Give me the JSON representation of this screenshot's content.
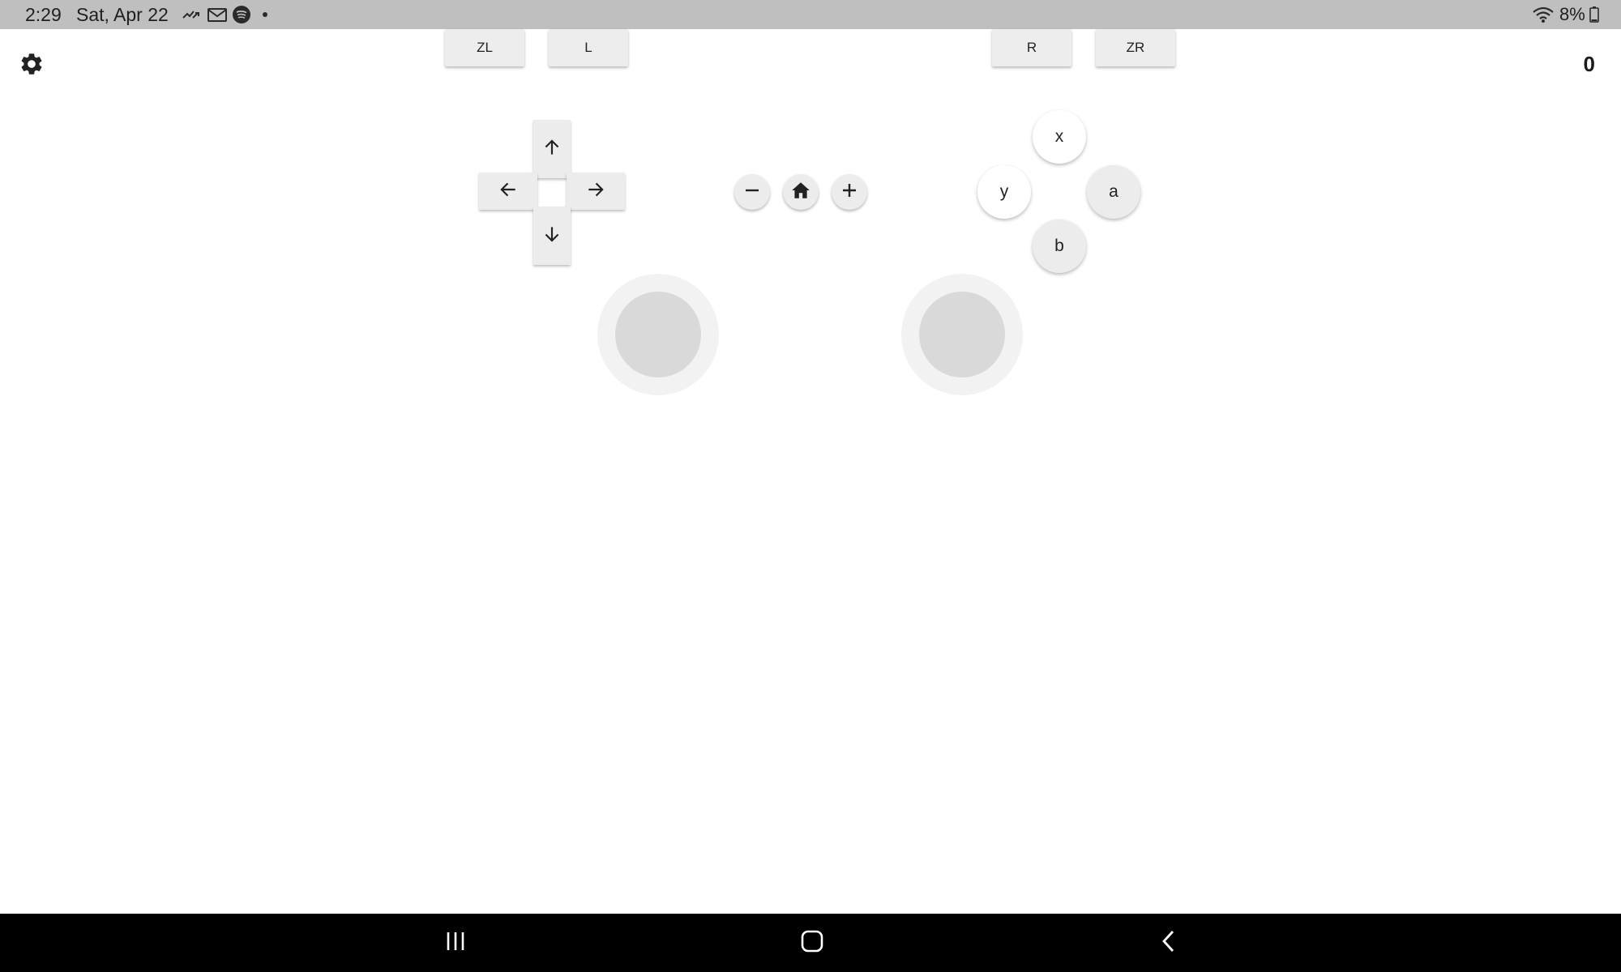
{
  "status_bar": {
    "time": "2:29",
    "date": "Sat, Apr 22",
    "notification_icons": [
      "missed-call-icon",
      "gmail-icon",
      "spotify-icon",
      "more-dot-icon"
    ],
    "battery_text": "8%",
    "background": "#bfbfbf"
  },
  "app": {
    "counter": "0",
    "shoulder_buttons": {
      "zl": "ZL",
      "l": "L",
      "r": "R",
      "zr": "ZR"
    },
    "face_buttons": {
      "x": "x",
      "y": "y",
      "a": "a",
      "b": "b"
    },
    "dpad_icons": [
      "arrow-up-icon",
      "arrow-left-icon",
      "arrow-right-icon",
      "arrow-down-icon"
    ],
    "system_icons": [
      "minus-icon",
      "home-icon",
      "plus-icon"
    ]
  },
  "nav_bar": {
    "buttons": [
      "recents-icon",
      "home-icon",
      "back-icon"
    ],
    "background": "#000000"
  }
}
